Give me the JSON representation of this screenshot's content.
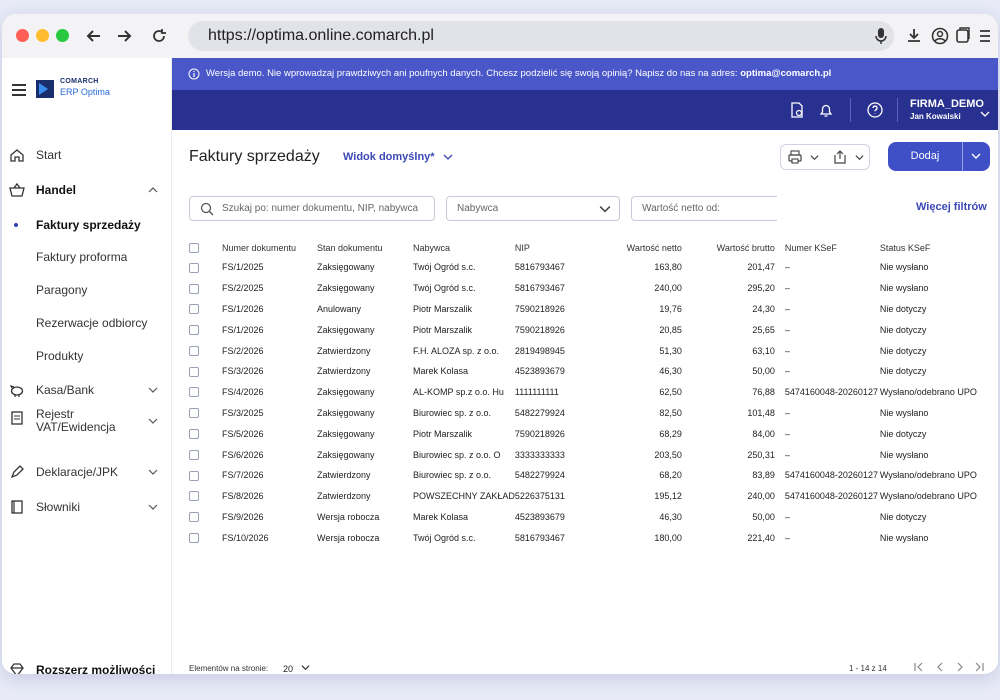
{
  "browser": {
    "url": "https://optima.online.comarch.pl"
  },
  "logo": {
    "line1": "COMARCH",
    "line2": "ERP Optima"
  },
  "sidebar": {
    "items": [
      {
        "label": "Start",
        "icon": "home-icon"
      },
      {
        "label": "Handel",
        "icon": "basket-icon"
      },
      {
        "label": "Faktury sprzedaży"
      },
      {
        "label": "Faktury proforma"
      },
      {
        "label": "Paragony"
      },
      {
        "label": "Rezerwacje odbiorcy"
      },
      {
        "label": "Produkty"
      },
      {
        "label": "Kasa/Bank",
        "icon": "piggy-bank-icon"
      },
      {
        "label": "Rejestr VAT/Ewidencja",
        "icon": "register-icon"
      },
      {
        "label": "Deklaracje/JPK",
        "icon": "pen-icon"
      },
      {
        "label": "Słowniki",
        "icon": "book-icon"
      }
    ],
    "bottom": {
      "label": "Rozszerz możliwości",
      "icon": "diamond-icon"
    }
  },
  "banner": {
    "text": "Wersja demo. Nie wprowadzaj prawdziwych ani poufnych danych. Chcesz podzielić się swoją opinią? Napisz do nas na adres: ",
    "email": "optima@comarch.pl"
  },
  "topbar": {
    "company": "FIRMA_DEMO",
    "user": "Jan Kowalski"
  },
  "page": {
    "title": "Faktury sprzedaży",
    "view": "Widok domyślny*",
    "add_label": "Dodaj",
    "search_placeholder": "Szukaj po: numer dokumentu, NIP, nabywca",
    "buyer_placeholder": "Nabywca",
    "net_placeholder": "Wartość netto od:",
    "more_filters": "Więcej filtrów"
  },
  "table": {
    "columns": [
      "Numer dokumentu",
      "Stan dokumentu",
      "Nabywca",
      "NIP",
      "Wartość netto",
      "Wartość brutto",
      "Numer KSeF",
      "Status KSeF"
    ],
    "rows": [
      [
        "FS/1/2025",
        "Zaksięgowany",
        "Twój Ogród s.c.",
        "5816793467",
        "163,80",
        "201,47",
        "–",
        "Nie wysłano"
      ],
      [
        "FS/2/2025",
        "Zaksięgowany",
        "Twój Ogród s.c.",
        "5816793467",
        "240,00",
        "295,20",
        "–",
        "Nie wysłano"
      ],
      [
        "FS/1/2026",
        "Anulowany",
        "Piotr Marszalik",
        "7590218926",
        "19,76",
        "24,30",
        "–",
        "Nie dotyczy"
      ],
      [
        "FS/1/2026",
        "Zaksięgowany",
        "Piotr Marszalik",
        "7590218926",
        "20,85",
        "25,65",
        "–",
        "Nie dotyczy"
      ],
      [
        "FS/2/2026",
        "Zatwierdzony",
        "F.H. ALOZA sp. z o.o.",
        "2819498945",
        "51,30",
        "63,10",
        "–",
        "Nie dotyczy"
      ],
      [
        "FS/3/2026",
        "Zatwierdzony",
        "Marek Kolasa",
        "4523893679",
        "46,30",
        "50,00",
        "–",
        "Nie dotyczy"
      ],
      [
        "FS/4/2026",
        "Zaksięgowany",
        "AL-KOMP sp.z o.o. Hu",
        "1111111111",
        "62,50",
        "76,88",
        "5474160048-20260127",
        "Wysłano/odebrano UPO"
      ],
      [
        "FS/3/2025",
        "Zaksięgowany",
        "Biurowiec sp. z o.o.",
        "5482279924",
        "82,50",
        "101,48",
        "–",
        "Nie wysłano"
      ],
      [
        "FS/5/2026",
        "Zaksięgowany",
        "Piotr Marszalik",
        "7590218926",
        "68,29",
        "84,00",
        "–",
        "Nie dotyczy"
      ],
      [
        "FS/6/2026",
        "Zaksięgowany",
        "Biurowiec sp. z o.o. O",
        "3333333333",
        "203,50",
        "250,31",
        "–",
        "Nie wysłano"
      ],
      [
        "FS/7/2026",
        "Zatwierdzony",
        "Biurowiec sp. z o.o.",
        "5482279924",
        "68,20",
        "83,89",
        "5474160048-20260127",
        "Wysłano/odebrano UPO"
      ],
      [
        "FS/8/2026",
        "Zatwierdzony",
        "POWSZECHNY ZAKŁAD",
        "5226375131",
        "195,12",
        "240,00",
        "5474160048-20260127",
        "Wysłano/odebrano UPO"
      ],
      [
        "FS/9/2026",
        "Wersja robocza",
        "Marek Kolasa",
        "4523893679",
        "46,30",
        "50,00",
        "–",
        "Nie dotyczy"
      ],
      [
        "FS/10/2026",
        "Wersja robocza",
        "Twój Ogród s.c.",
        "5816793467",
        "180,00",
        "221,40",
        "–",
        "Nie wysłano"
      ]
    ]
  },
  "footer": {
    "per_page_label": "Elementów na stronie:",
    "per_page_value": "20",
    "range": "1 - 14 z 14"
  },
  "colors": {
    "accent": "#3f4fc6",
    "topbar": "#28318f",
    "banner": "#4a57c8",
    "draft": "#2e8b3a"
  }
}
